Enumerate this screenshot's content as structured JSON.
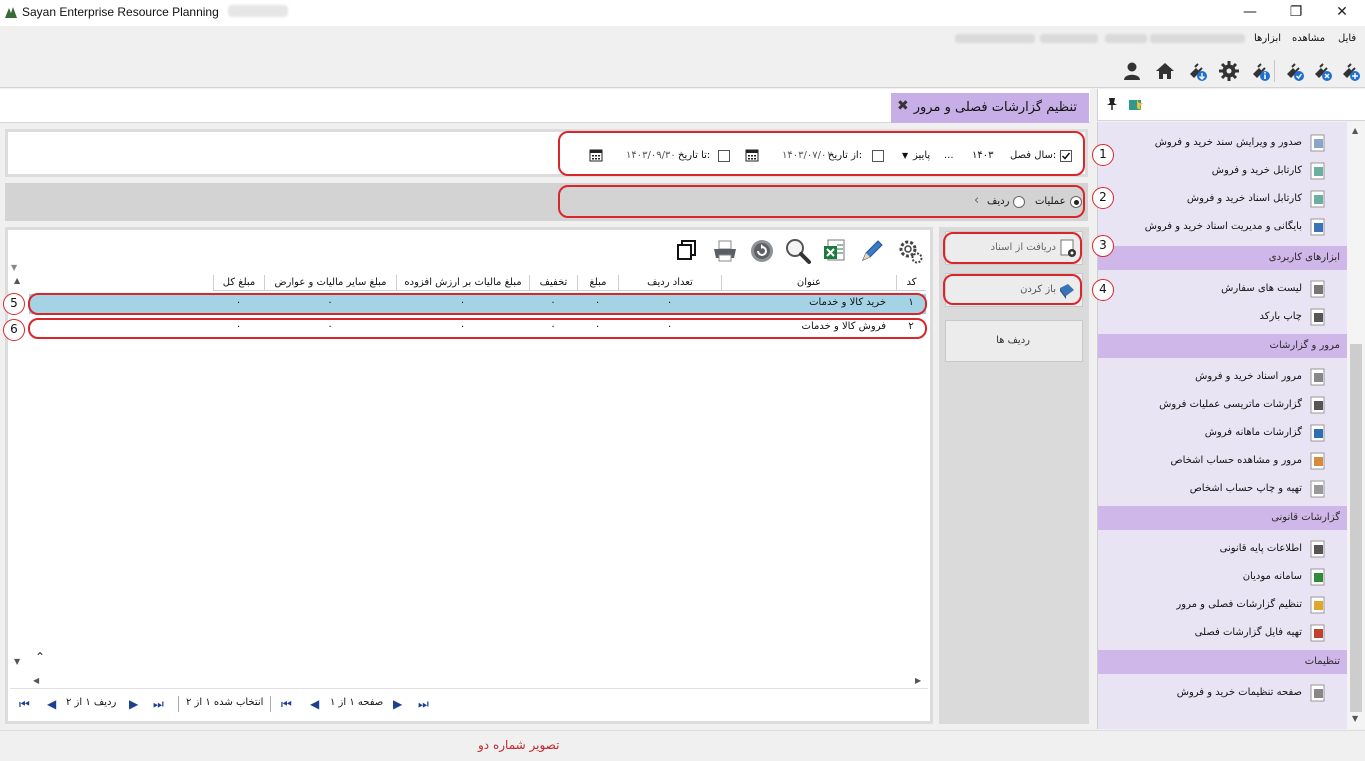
{
  "window": {
    "title": "Sayan Enterprise Resource Planning",
    "minimize": "—",
    "maximize": "❐",
    "close": "✕"
  },
  "menu": [
    "فایل",
    "مشاهده",
    "ابزارها"
  ],
  "tab": {
    "title": "تنظیم گزارشات فصلی و مرور",
    "close": "✖"
  },
  "filters": {
    "season_year_label": "سال فصل:",
    "season_year_value": "۱۴۰۳",
    "season_year_checked": true,
    "ellipsis": "...",
    "season_value": "پاییز",
    "from_date_label": "از تاریخ:",
    "from_date_value": "۱۴۰۳/۰۷/۰۱",
    "to_date_label": "تا تاریخ:",
    "to_date_value": "۱۴۰۳/۰۹/۳۰"
  },
  "ops": {
    "operations_label": "عملیات",
    "row_label": "ردیف",
    "selected": "operations"
  },
  "side": {
    "receive_from_docs": "دریافت از اسناد",
    "open": "باز کردن",
    "rows": "ردیف ها"
  },
  "grid": {
    "columns": [
      "کد",
      "عنوان",
      "تعداد ردیف",
      "مبلغ",
      "تخفیف",
      "مبلغ مالیات بر ارزش افزوده",
      "مبلغ سایر مالیات و عوارض",
      "مبلغ کل"
    ],
    "rows": [
      [
        "۱",
        "خرید کالا و خدمات",
        "۰",
        "۰",
        "۰",
        "۰",
        "۰",
        "۰"
      ],
      [
        "۲",
        "فروش کالا و خدمات",
        "۰",
        "۰",
        "۰",
        "۰",
        "۰",
        "۰"
      ]
    ],
    "selected_row": 0
  },
  "pager": {
    "rows_info": "ردیف ۱ از ۲",
    "selection_info": "انتخاب شده ۱ از ۲",
    "page_info": "صفحه ۱ از ۱"
  },
  "annotations": [
    "1",
    "2",
    "3",
    "4",
    "5",
    "6"
  ],
  "caption": "تصویر شماره دو",
  "nav": {
    "top_items": [
      "صدور و ویرایش سند خرید و فروش",
      "کارتابل خرید و فروش",
      "کارتابل اسناد خرید و فروش",
      "بایگانی و مدیریت اسناد خرید و فروش"
    ],
    "sections": [
      {
        "title": "ابزارهای کاربردی",
        "items": [
          "لیست های سفارش",
          "چاپ بارکد"
        ]
      },
      {
        "title": "مرور و گزارشات",
        "items": [
          "مرور اسناد خرید و فروش",
          "گزارشات ماتریسی عملیات فروش",
          "گزارشات ماهانه فروش",
          "مرور و مشاهده حساب اشخاص",
          "تهیه و چاپ حساب اشخاص"
        ]
      },
      {
        "title": "گزارشات قانونی",
        "items": [
          "اطلاعات پایه قانونی",
          "سامانه مودیان",
          "تنظیم گزارشات فصلی و مرور",
          "تهیه فایل گزارشات فصلی"
        ]
      },
      {
        "title": "تنظیمات",
        "items": [
          "صفحه تنظیمات خرید و فروش"
        ]
      }
    ]
  },
  "colors": {
    "accent": "#c8aee6",
    "nav_bg": "#e9e4f3",
    "section": "#cfb7ea",
    "selected_row": "#a5d3e6",
    "annotation": "#d9262b"
  }
}
